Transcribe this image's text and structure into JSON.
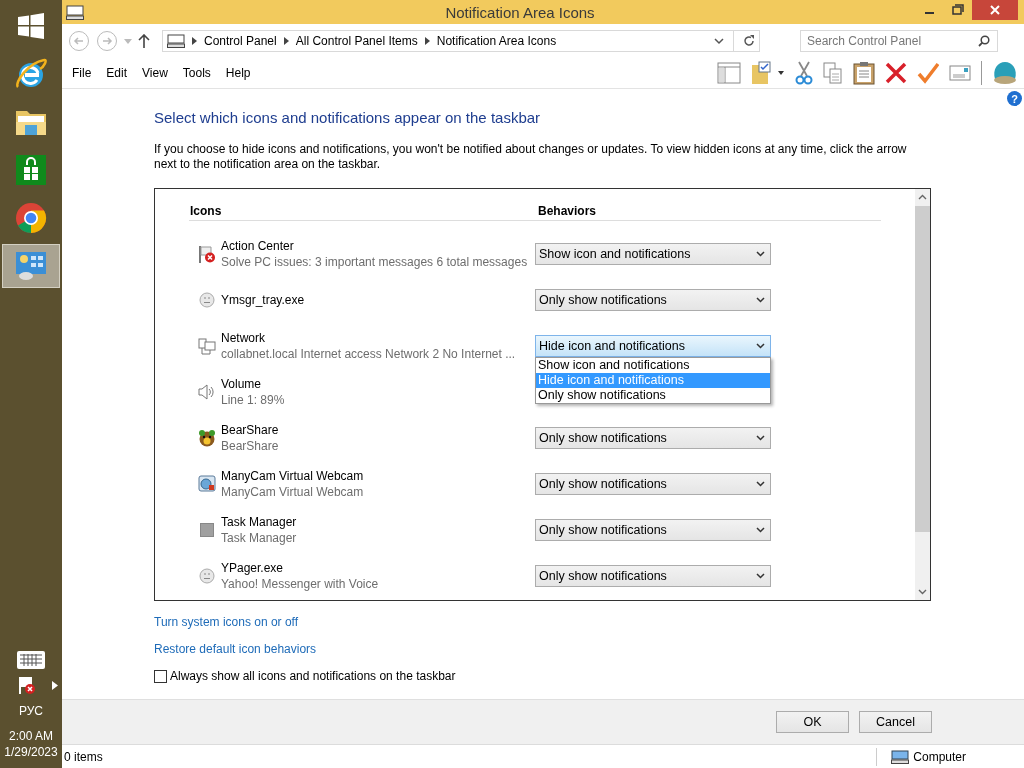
{
  "taskbar": {
    "apps": [
      {
        "kind": "start",
        "selected": false
      },
      {
        "kind": "ie",
        "selected": false
      },
      {
        "kind": "explorer",
        "selected": false
      },
      {
        "kind": "store",
        "selected": false
      },
      {
        "kind": "chrome",
        "selected": false
      },
      {
        "kind": "control",
        "selected": true
      }
    ],
    "language": "РУС",
    "time": "2:00 AM",
    "date": "1/29/2023"
  },
  "window": {
    "title": "Notification Area Icons"
  },
  "address_bar": {
    "breadcrumbs": [
      "Control Panel",
      "All Control Panel Items",
      "Notification Area Icons"
    ],
    "search_placeholder": "Search Control Panel"
  },
  "menu": [
    "File",
    "Edit",
    "View",
    "Tools",
    "Help"
  ],
  "help": "?",
  "heading": "Select which icons and notifications appear on the taskbar",
  "description": "If you choose to hide icons and notifications, you won't be notified about changes or updates. To view hidden icons at any time, click the arrow next to the notification area on the taskbar.",
  "table": {
    "columns": [
      "Icons",
      "Behaviors"
    ],
    "rows": [
      {
        "kind": "flag",
        "name": "Action Center",
        "detail": "Solve PC issues: 3 important messages  6 total messages",
        "behavior": "Show icon and notifications"
      },
      {
        "kind": "face",
        "name": "Ymsgr_tray.exe",
        "behavior": "Only show notifications"
      },
      {
        "kind": "network",
        "name": "Network",
        "detail": "collabnet.local Internet access  Network  2 No Internet ...",
        "behavior": "Hide icon and notifications",
        "open": true,
        "options": [
          {
            "label": "Show icon and notifications",
            "selected": false
          },
          {
            "label": "Hide icon and notifications",
            "selected": true
          },
          {
            "label": "Only show notifications",
            "selected": false
          }
        ]
      },
      {
        "kind": "speaker",
        "name": "Volume",
        "detail": "Line 1: 89%"
      },
      {
        "kind": "bear",
        "name": "BearShare",
        "detail": "BearShare",
        "behavior": "Only show notifications"
      },
      {
        "kind": "webcam",
        "name": "ManyCam Virtual Webcam",
        "detail": "ManyCam Virtual Webcam",
        "behavior": "Only show notifications"
      },
      {
        "kind": "square",
        "name": "Task Manager",
        "detail": "Task Manager",
        "behavior": "Only show notifications"
      },
      {
        "kind": "face",
        "name": "YPager.exe",
        "detail": "Yahoo! Messenger with Voice",
        "behavior": "Only show notifications"
      }
    ]
  },
  "links": [
    "Turn system icons on or off",
    "Restore default icon behaviors"
  ],
  "always_show": {
    "label": "Always show all icons and notifications on the taskbar",
    "checked": false
  },
  "buttons": [
    "OK",
    "Cancel"
  ],
  "status_bar": {
    "items": "0 items",
    "location": "Computer"
  }
}
